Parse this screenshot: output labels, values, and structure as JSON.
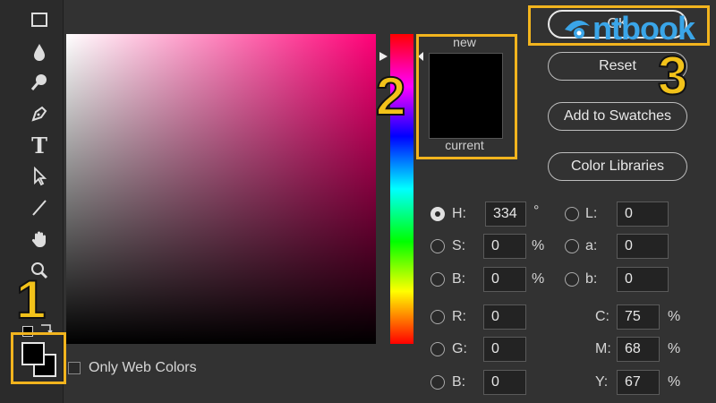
{
  "toolbar": {
    "tools": [
      {
        "icon": "rectangle-icon"
      },
      {
        "icon": "blur-drop-icon"
      },
      {
        "icon": "dodge-icon"
      },
      {
        "icon": "pen-icon"
      },
      {
        "icon": "type-icon",
        "glyph": "T"
      },
      {
        "icon": "path-selection-icon"
      },
      {
        "icon": "line-icon"
      },
      {
        "icon": "hand-icon"
      },
      {
        "icon": "zoom-icon"
      }
    ],
    "foreground_color": "#000000",
    "background_color": "#000000"
  },
  "preview": {
    "new_label": "new",
    "current_label": "current",
    "new_color": "#000000",
    "current_color": "#000000"
  },
  "buttons": {
    "ok": "OK",
    "reset": "Reset",
    "add_to_swatches": "Add to Swatches",
    "color_libraries": "Color Libraries"
  },
  "hsb": {
    "h": {
      "label": "H:",
      "value": "334",
      "unit": "°",
      "selected": true
    },
    "s": {
      "label": "S:",
      "value": "0",
      "unit": "%"
    },
    "b": {
      "label": "B:",
      "value": "0",
      "unit": "%"
    }
  },
  "rgb": {
    "r": {
      "label": "R:",
      "value": "0"
    },
    "g": {
      "label": "G:",
      "value": "0"
    },
    "b": {
      "label": "B:",
      "value": "0"
    }
  },
  "lab": {
    "l": {
      "label": "L:",
      "value": "0"
    },
    "a": {
      "label": "a:",
      "value": "0"
    },
    "b": {
      "label": "b:",
      "value": "0"
    }
  },
  "cmyk": {
    "c": {
      "label": "C:",
      "value": "75",
      "unit": "%"
    },
    "m": {
      "label": "M:",
      "value": "68",
      "unit": "%"
    },
    "y": {
      "label": "Y:",
      "value": "67",
      "unit": "%"
    }
  },
  "only_web_colors": {
    "label": "Only Web Colors",
    "checked": false
  },
  "annotations": {
    "one": "1",
    "two": "2",
    "three": "3"
  },
  "watermark": {
    "text": "ntbook"
  },
  "colors": {
    "highlight": "#f2b41e",
    "field_hue": "#ff0077",
    "panel_bg": "#323232"
  }
}
